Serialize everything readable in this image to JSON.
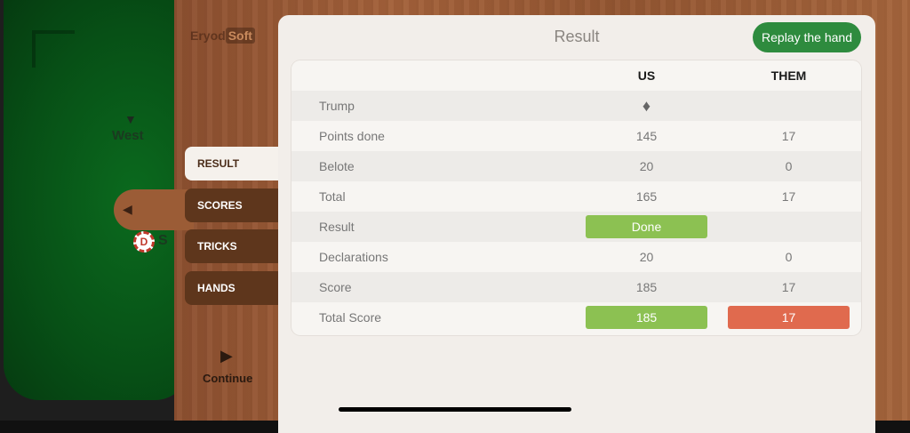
{
  "table": {
    "west_label": "West",
    "dealer_chip": "D",
    "chip_tail": "S"
  },
  "brand": {
    "part1": "Eryod",
    "part2": "Soft"
  },
  "menu": {
    "items": [
      {
        "label": "RESULT"
      },
      {
        "label": "SCORES"
      },
      {
        "label": "TRICKS"
      },
      {
        "label": "HANDS"
      }
    ],
    "active": "RESULT"
  },
  "continue_label": "Continue",
  "result": {
    "title": "Result",
    "replay_label": "Replay the hand",
    "headers": {
      "us": "US",
      "them": "THEM"
    },
    "rows": [
      {
        "label": "Trump",
        "us": "♦",
        "them": ""
      },
      {
        "label": "Points done",
        "us": "145",
        "them": "17"
      },
      {
        "label": "Belote",
        "us": "20",
        "them": "0"
      },
      {
        "label": "Total",
        "us": "165",
        "them": "17"
      },
      {
        "label": "Result",
        "us": "Done",
        "them": ""
      },
      {
        "label": "Declarations",
        "us": "20",
        "them": "0"
      },
      {
        "label": "Score",
        "us": "185",
        "them": "17"
      },
      {
        "label": "Total Score",
        "us": "185",
        "them": "17"
      }
    ]
  },
  "colors": {
    "win": "#8cc152",
    "lose": "#e06a4e",
    "accent": "#2e8b3e"
  },
  "icons": {
    "back": "chevron-left-icon",
    "continue": "play-icon",
    "trump": "diamond-icon"
  }
}
